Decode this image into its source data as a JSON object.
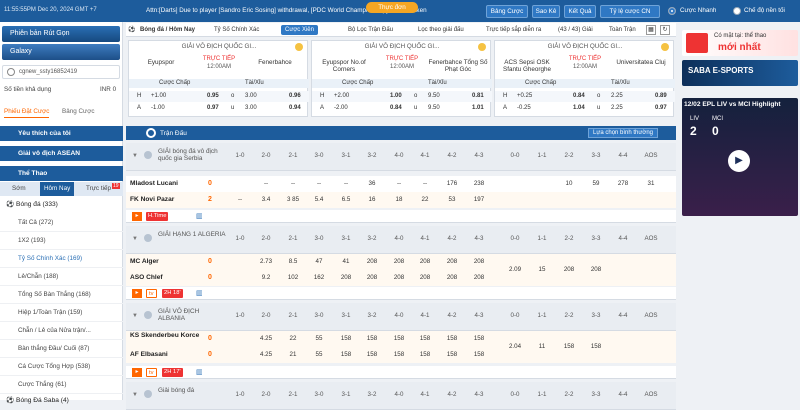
{
  "topbar": {
    "time": "11:55:55PM Dec 20, 2024 GMT +7",
    "ticker": "Attn:[Darts] Due to player [Sandro Eric Sosing] withdrawal, [PDC World Championship] all bets taken",
    "thuc_don": "Thực đơn",
    "buttons": [
      "Bảng Cược",
      "Sao Kê",
      "Kết Quả",
      "Tỷ lệ cược CN"
    ],
    "quick_bet": "Cược Nhanh",
    "dark_mode": "Chế độ nền tối"
  },
  "sidebar": {
    "btn_rut_gon": "Phiên bản Rút Gọn",
    "btn_galaxy": "Galaxy",
    "username": "cgnew_ssty16852419",
    "balance_label": "Số tiền khả dụng",
    "balance_value": "INR 0",
    "tab_pending": "Phiếu Đặt Cược",
    "tab_bettable": "Bảng Cược",
    "favorites": "Yêu thích của tôi",
    "asean": "Giải vô địch ASEAN",
    "sports": "Thể Thao",
    "time_tabs": [
      "Sớm",
      "Hôm Nay",
      "Trực tiếp"
    ],
    "live_count": "19",
    "football": "Bóng đá",
    "football_count": "(333)",
    "items": [
      "Tất Cả (272)",
      "1X2 (193)",
      "Tỷ Số Chính Xác (169)",
      "Lẻ/Chẵn (188)",
      "Tổng Số Bàn Thắng (168)",
      "Hiệp 1/Toàn Trận (159)",
      "Chẵn / Lẻ của Nửa trận/...",
      "Bàn thắng Đầu/ Cuối (87)",
      "Cá Cược Tổng Hợp (538)",
      "Cược Thắng (61)"
    ],
    "saba": "Bóng Đá Saba",
    "saba_count": "(4)"
  },
  "filter": {
    "sport": "Bóng đá / Hôm Nay",
    "main_odds": "Tỷ Số Chính Xác",
    "cuoc_xien": "Cược Xiên",
    "filter_match": "Bộ Lọc Trận Đấu",
    "sort": "Lọc theo giải đấu",
    "hot": "Trực tiếp sắp diễn ra",
    "count": "(43 / 43) Giải",
    "full": "Toàn Trận"
  },
  "cards": [
    {
      "league": "GIẢI VÔ ĐỊCH QUỐC GI...",
      "home": "Eyupspor",
      "away": "Fenerbahce",
      "live": "TRỰC TIẾP",
      "time": "12:00AM",
      "hdp_label": "Cược Chấp",
      "ou_label": "Tài/Xỉu",
      "rows": [
        [
          "H",
          "+1.00",
          "0.95",
          "o",
          "3.00",
          "0.96"
        ],
        [
          "A",
          "-1.00",
          "0.97",
          "u",
          "3.00",
          "0.94"
        ]
      ]
    },
    {
      "league": "GIẢI VÔ ĐỊCH QUỐC GI...",
      "home": "Eyupspor No.of Corners",
      "away": "Fenerbahce Tổng Số Phạt Góc",
      "live": "TRỰC TIẾP",
      "time": "12:00AM",
      "hdp_label": "Cược Chấp",
      "ou_label": "Tài/Xỉu",
      "rows": [
        [
          "H",
          "+2.00",
          "1.00",
          "o",
          "9.50",
          "0.81"
        ],
        [
          "A",
          "-2.00",
          "0.84",
          "u",
          "9.50",
          "1.01"
        ]
      ]
    },
    {
      "league": "GIẢI VÔ ĐỊCH QUỐC GI...",
      "home": "ACS Sepsi OSK Sfantu Gheorghe",
      "away": "Universitatea Cluj",
      "live": "TRỰC TIẾP",
      "time": "12:00AM",
      "hdp_label": "Cược Chấp",
      "ou_label": "Tài/Xỉu",
      "rows": [
        [
          "H",
          "+0.25",
          "0.84",
          "o",
          "2.25",
          "0.89"
        ],
        [
          "A",
          "-0.25",
          "1.04",
          "u",
          "2.25",
          "0.97"
        ]
      ]
    }
  ],
  "table": {
    "title": "Trận Đấu",
    "sort_label": "Lựa chọn bình thường",
    "score_cols": [
      "1-0",
      "2-0",
      "2-1",
      "3-0",
      "3-1",
      "3-2",
      "4-0",
      "4-1",
      "4-2",
      "4-3",
      "0-0",
      "1-1",
      "2-2",
      "3-3",
      "4-4",
      "AOS"
    ],
    "leagues": [
      {
        "name": "GIẢI bóng đá vô địch quốc gia Serbia",
        "home": "Mladost Lucani",
        "away": "FK Novi Pazar",
        "hs": "0",
        "as": "2",
        "home_odds": [
          "--",
          "--",
          "--",
          "--",
          "36",
          "--",
          "--",
          "176",
          "238"
        ],
        "away_odds": [
          "--",
          "3.4",
          "3 85",
          "5.4",
          "6.5",
          "16",
          "18",
          "22",
          "53",
          "197"
        ],
        "right_home": [
          "10",
          "59",
          "278",
          "31"
        ],
        "status": "H.Time"
      },
      {
        "name": "GIẢI HẠNG 1 ALGERIA",
        "home": "MC Alger",
        "away": "ASO Chlef",
        "hs": "0",
        "as": "0",
        "home_odds": [
          "2.73",
          "8.5",
          "47",
          "41",
          "208",
          "208",
          "208",
          "208",
          "208"
        ],
        "away_odds": [
          "9.2",
          "102",
          "162",
          "208",
          "208",
          "208",
          "208",
          "208",
          "208"
        ],
        "right_mid": [
          "2.09",
          "15",
          "208",
          "208"
        ],
        "status_time": "2H 18'"
      },
      {
        "name": "GIẢI VÔ ĐỊCH ALBANIA",
        "home": "KS Skenderbeu Korce",
        "away": "AF Elbasani",
        "hs": "0",
        "as": "0",
        "home_odds": [
          "4.25",
          "22",
          "55",
          "158",
          "158",
          "158",
          "158",
          "158",
          "158"
        ],
        "away_odds": [
          "4.25",
          "21",
          "55",
          "158",
          "158",
          "158",
          "158",
          "158",
          "158"
        ],
        "right_mid": [
          "2.04",
          "11",
          "158",
          "158"
        ],
        "status_time": "2H 17'"
      },
      {
        "name": "Giải bóng đá"
      }
    ]
  },
  "promo": {
    "banner1_small": "Có mặt tại: thể thao",
    "banner1_big": "mới nhất",
    "banner2": "SABA E-SPORTS",
    "video_title": "12/02 EPL LIV vs MCI Highlight",
    "score_home": "2",
    "score_away": "0",
    "team_home": "LIV",
    "team_away": "MCI"
  },
  "colors": {
    "brand": "#1d5c9c",
    "accent": "#f60",
    "live": "#e33"
  }
}
